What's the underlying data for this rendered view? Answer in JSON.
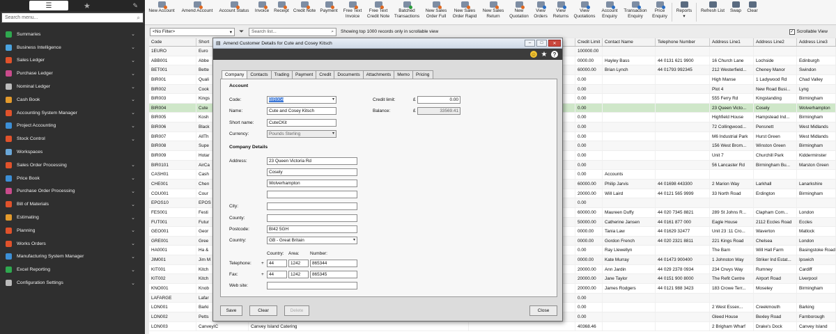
{
  "sidebar": {
    "search_placeholder": "Search menu...",
    "items": [
      {
        "label": "Summaries",
        "color": "#2fa84f"
      },
      {
        "label": "Business Intelligence",
        "color": "#4aa3df"
      },
      {
        "label": "Sales Ledger",
        "color": "#e0522b"
      },
      {
        "label": "Purchase Ledger",
        "color": "#c94b8c"
      },
      {
        "label": "Nominal Ledger",
        "color": "#bbbbbb"
      },
      {
        "label": "Cash Book",
        "color": "#e39a2c"
      },
      {
        "label": "Accounting System Manager",
        "color": "#e0522b"
      },
      {
        "label": "Project Accounting",
        "color": "#3c8fd6"
      },
      {
        "label": "Stock Control",
        "color": "#e0522b"
      },
      {
        "label": "Workspaces",
        "color": "#6aa7d8"
      },
      {
        "label": "Sales Order Processing",
        "color": "#e0522b"
      },
      {
        "label": "Price Book",
        "color": "#3c8fd6"
      },
      {
        "label": "Purchase Order Processing",
        "color": "#c94b8c"
      },
      {
        "label": "Bill of Materials",
        "color": "#e0522b"
      },
      {
        "label": "Estimating",
        "color": "#e39a2c"
      },
      {
        "label": "Planning",
        "color": "#e0522b"
      },
      {
        "label": "Works Orders",
        "color": "#e0522b"
      },
      {
        "label": "Manufacturing System Manager",
        "color": "#3c8fd6"
      },
      {
        "label": "Excel Reporting",
        "color": "#2fa84f"
      },
      {
        "label": "Configuration Settings",
        "color": "#bbbbbb"
      }
    ]
  },
  "toolbar": {
    "buttons": [
      {
        "label": "New Account",
        "w": 48,
        "c": "#f0f0f0",
        "k": ""
      },
      {
        "label": "Amend Account",
        "w": 54,
        "c": "#f0f0f0",
        "k": ""
      },
      {
        "label": "Account Status",
        "w": 52,
        "c": "#f0f0f0",
        "k": ""
      },
      {
        "label": "Invoice",
        "w": 28,
        "c": "#f0f0f0",
        "k": ""
      },
      {
        "label": "Receipt",
        "w": 28,
        "c": "#f0f0f0",
        "k": ""
      },
      {
        "label": "Credit Note",
        "w": 38,
        "c": "#f0f0f0",
        "k": ""
      },
      {
        "label": "Payment",
        "w": 32,
        "c": "#f0f0f0",
        "k": ""
      },
      {
        "label": "Free Text\nInvoice",
        "w": 36,
        "c": "#f0f0f0",
        "k": ""
      },
      {
        "label": "Free Text\nCredit Note",
        "w": 38,
        "c": "#f0f0f0",
        "k": ""
      },
      {
        "label": "Batched\nTransactions",
        "w": 44,
        "c": "#f0f0f0",
        "k": "g"
      },
      {
        "label": "New Sales\nOrder Full",
        "w": 40,
        "c": "#f0f0f0",
        "k": ""
      },
      {
        "label": "New Sales\nOrder Rapid",
        "w": 42,
        "c": "#f0f0f0",
        "k": ""
      },
      {
        "label": "New Sales\nReturn",
        "w": 40,
        "c": "#f0f0f0",
        "k": ""
      },
      {
        "label": "New\nQuotation",
        "w": 34,
        "c": "#f0f0f0",
        "k": ""
      },
      {
        "label": "View\nOrders",
        "w": 28,
        "c": "#f0f0f0",
        "k": "b"
      },
      {
        "label": "View\nReturns",
        "w": 30,
        "c": "#f0f0f0",
        "k": "b"
      },
      {
        "label": "View\nQuotations",
        "w": 38,
        "c": "#f0f0f0",
        "k": "b"
      },
      {
        "label": "Account\nEnquiry",
        "w": 34,
        "c": "#f0f0f0",
        "k": "b"
      },
      {
        "label": "Transaction\nEnquiry",
        "w": 40,
        "c": "#f0f0f0",
        "k": "b"
      },
      {
        "label": "Price\nEnquiry",
        "w": 30,
        "c": "#f0f0f0",
        "k": "b"
      },
      {
        "label": "Reports\n▾",
        "w": 30,
        "c": "#f0f0f0",
        "k": "n"
      },
      {
        "label": "Refresh List",
        "w": 42,
        "c": "#f0f0f0",
        "k": "n"
      },
      {
        "label": "Swap",
        "w": 24,
        "c": "#f0f0f0",
        "k": "n"
      },
      {
        "label": "Clear",
        "w": 24,
        "c": "#f0f0f0",
        "k": "n"
      }
    ]
  },
  "filter": {
    "value": "<No Filter>",
    "search_placeholder": "Search list...",
    "note": "Showing top 1000 records only in scrollable view",
    "scrollable_label": "Scrollable View"
  },
  "grid": {
    "columns": [
      "Code",
      "Short",
      "",
      "",
      "Credit Limit",
      "Contact Name",
      "Telephone Number",
      "Address Line1",
      "Address Line2",
      "Address Line3"
    ],
    "rows": [
      [
        "1EURO",
        "Euro",
        "",
        "",
        "100000.00",
        "",
        "",
        "",
        "",
        ""
      ],
      [
        "ABB001",
        "Abbe",
        "",
        "",
        "0000.00",
        "Hayley Bass",
        "44 0131 621 9900",
        "16 Church Lane",
        "Lochside",
        "Edinburgh"
      ],
      [
        "BET001",
        "Bette",
        "",
        "",
        "60000.00",
        "Brian Lynch",
        "44 01793 992345",
        "212 Westerfield...",
        "Cheney Manor",
        "Swindon"
      ],
      [
        "BIR001",
        "Quali",
        "",
        "",
        "0.00",
        "",
        "",
        "High Manse",
        "1 Ladywood Rd",
        "Chad Valley"
      ],
      [
        "BIR002",
        "Cook",
        "",
        "",
        "0.00",
        "",
        "",
        "Plot 4",
        "New Road Busi...",
        "Lyng"
      ],
      [
        "BIR003",
        "Kings",
        "",
        "",
        "0.00",
        "",
        "",
        "555 Ferry Rd",
        "Kingstanding",
        "Birmingham"
      ],
      [
        "BIR004",
        "Cute",
        "",
        "",
        "0.00",
        "",
        "",
        "23 Queen Victo...",
        "Cosely",
        "Wolverhampton"
      ],
      [
        "BIR005",
        "Kosh",
        "",
        "",
        "0.00",
        "",
        "",
        "Highfield House",
        "Hampstead Ind...",
        "Birmingham"
      ],
      [
        "BIR006",
        "Black",
        "",
        "",
        "0.00",
        "",
        "",
        "72 Collingwood...",
        "Pensnett",
        "West Midlands"
      ],
      [
        "BIR007",
        "AllTh",
        "",
        "",
        "0.00",
        "",
        "",
        "M6 Industrial Park",
        "Hurst Green",
        "West Midlands"
      ],
      [
        "BIR008",
        "Supe",
        "",
        "",
        "0.00",
        "",
        "",
        "156 West Brom...",
        "Winston Green",
        "Birmingham"
      ],
      [
        "BIR009",
        "Hotar",
        "",
        "",
        "0.00",
        "",
        "",
        "Unit 7",
        "Churchill Park",
        "Kidderminster"
      ],
      [
        "BIR0101",
        "AirCa",
        "",
        "",
        "0.00",
        "",
        "",
        "56 Lancaster Rd",
        "Birmingham Bu...",
        "Marston Green"
      ],
      [
        "CASH01",
        "Cash",
        "",
        "",
        "0.00",
        "Accounts",
        "",
        "",
        "",
        ""
      ],
      [
        "CHE001",
        "Chen",
        "",
        "",
        "60000.00",
        "Philip Jarvis",
        "44 01698 443300",
        "2 Marion Way",
        "Larkhall",
        "Lanarkshire"
      ],
      [
        "COU001",
        "Cour",
        "",
        "",
        "20000.00",
        "Will Laird",
        "44 0121 565 9999",
        "33 North Road",
        "Erdington",
        "Birmingham"
      ],
      [
        "EPOS10",
        "EPOS",
        "",
        "",
        "0.00",
        "",
        "",
        "",
        "",
        ""
      ],
      [
        "FES001",
        "Festi",
        "",
        "",
        "60000.00",
        "Maureen Duffy",
        "44 020 7345 8821",
        "289 St Johns R...",
        "Clapham Com...",
        "London"
      ],
      [
        "FUT001",
        "Futur",
        "",
        "",
        "50000.00",
        "Catherine Jansen",
        "44 0161 877 000",
        "Eagle House",
        "2112 Eccles Road",
        "Eccles"
      ],
      [
        "GEO001",
        "Geor",
        "",
        "",
        "0000.00",
        "Tania Law",
        "44 01629 32477",
        "Unit 23 :11 Cro...",
        "Waverton",
        "Matlock"
      ],
      [
        "GRE001",
        "Gree",
        "",
        "",
        "0000.00",
        "Gordon French",
        "44 020 2321 8811",
        "221 Kings Road",
        "Chelsea",
        "London"
      ],
      [
        "HA0001",
        "Ha &",
        "",
        "",
        "0.00",
        "Ray Llewellyn",
        "",
        "The Barn",
        "Will Hall Farm",
        "Basingstoke Road"
      ],
      [
        "JIM001",
        "Jim M",
        "",
        "",
        "0000.00",
        "Kate Murray",
        "44 01473 900400",
        "1 Johnston Way",
        "Striker Ind Estat...",
        "Ipswich"
      ],
      [
        "KIT001",
        "Kitch",
        "",
        "",
        "20000.00",
        "Ann Jardin",
        "44 029 2378 0934",
        "234 Crwys Way",
        "Rumney",
        "Cardiff"
      ],
      [
        "KIT002",
        "Kitch",
        "",
        "",
        "20000.00",
        "Jane Taylor",
        "44 0151 900 8000",
        "The Refit Centre",
        "Airport Road",
        "Liverpool"
      ],
      [
        "KNO001",
        "Knob",
        "",
        "",
        "20000.00",
        "James Rodgers",
        "44 0121 988 3423",
        "183 Crowe Terr...",
        "Moseley",
        "Birmingham"
      ],
      [
        "LAFARGE",
        "Lafar",
        "",
        "",
        "0.00",
        "",
        "",
        "",
        "",
        ""
      ],
      [
        "LON001",
        "Barki",
        "",
        "",
        "0.00",
        "",
        "",
        "2 West Essex...",
        "Creekmouth",
        "Barking"
      ],
      [
        "LON002",
        "Petts",
        "",
        "",
        "0.00",
        "",
        "",
        "Gleed House",
        "Bexley Road",
        "Farnborough"
      ],
      [
        "LON003",
        "CanveyIC",
        "Canvey Island Catering",
        "",
        "40368.46",
        "",
        "",
        "2 Brigham Wharf",
        "Drake's Dock",
        "Canvey Island"
      ]
    ]
  },
  "dialog": {
    "title": "Amend Customer Details for Cute and Cosey Kitsch",
    "tabs": [
      "Company",
      "Contacts",
      "Trading",
      "Payment",
      "Credit",
      "Documents",
      "Attachments",
      "Memo",
      "Pricing"
    ],
    "account_heading": "Account",
    "company_heading": "Company Details",
    "labels": {
      "code": "Code:",
      "name": "Name:",
      "short_name": "Short name:",
      "currency": "Currency:",
      "credit_limit": "Credit limit:",
      "balance": "Balance:",
      "address": "Address:",
      "city": "City:",
      "county": "County:",
      "postcode": "Postcode:",
      "country": "Country:",
      "telephone": "Telephone:",
      "fax": "Fax:",
      "website": "Web site:",
      "country_col": "Country:",
      "area_col": "Area:",
      "number_col": "Number:",
      "currency_symbol": "£",
      "plus": "+"
    },
    "values": {
      "code": "BIR004",
      "name": "Cute and Cosey Kitsch",
      "short_name": "CuteCKit",
      "currency": "Pounds Sterling",
      "credit_limit": "0.00",
      "balance": "33569.41",
      "address1": "23 Queen Victoria Rd",
      "address2": "Cosely",
      "address3": "Wolverhampton",
      "address4": "",
      "city": "",
      "county": "",
      "postcode": "BI42 5GH",
      "country": "GB - Great Britain",
      "tel_country": "44",
      "tel_area": "1242",
      "tel_number": "865344",
      "fax_country": "44",
      "fax_area": "1242",
      "fax_number": "865345",
      "website": ""
    },
    "buttons": {
      "save": "Save",
      "clear": "Clear",
      "delete": "Delete",
      "close": "Close"
    }
  }
}
